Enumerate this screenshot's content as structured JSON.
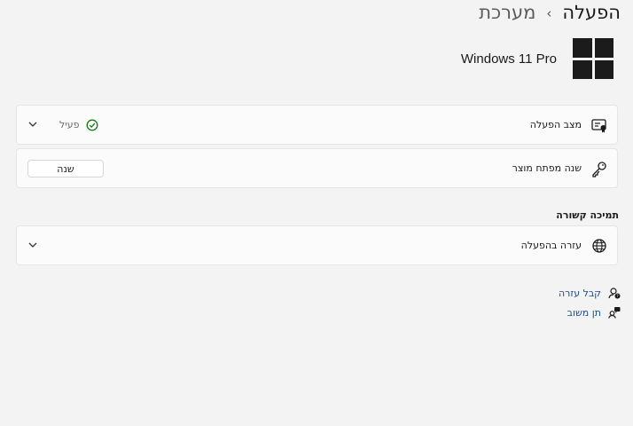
{
  "breadcrumb": {
    "parent": "מערכת",
    "separator": "›",
    "current": "הפעלה"
  },
  "product": {
    "name": "Windows 11 Pro",
    "logo_icon": "windows-logo-icon"
  },
  "activation_state": {
    "label": "מצב הפעלה",
    "status": "פעיל",
    "icon": "certificate-icon",
    "status_icon": "check-circle-icon",
    "expand_icon": "chevron-down-icon",
    "status_color": "#0f7b0f"
  },
  "product_key": {
    "label": "שנה מפתח מוצר",
    "icon": "key-icon",
    "button_label": "שנה"
  },
  "related_support": {
    "title": "תמיכה קשורה",
    "help_item": {
      "label": "עזרה בהפעלה",
      "icon": "globe-icon",
      "expand_icon": "chevron-down-icon"
    }
  },
  "links": {
    "get_help": {
      "label": "קבל עזרה",
      "icon": "help-person-icon"
    },
    "give_feedback": {
      "label": "תן משוב",
      "icon": "feedback-icon"
    }
  },
  "colors": {
    "background": "#f3f3f3",
    "card": "#fbfbfb",
    "link": "#1f4e8c"
  }
}
